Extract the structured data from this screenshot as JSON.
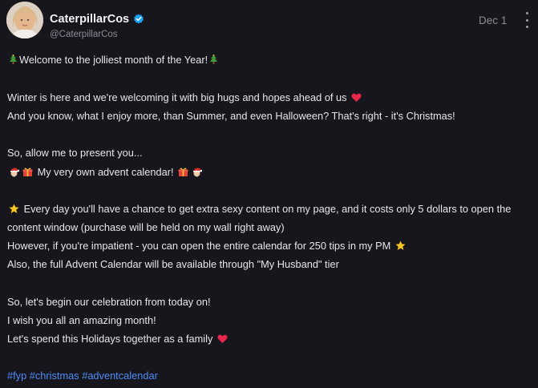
{
  "author": {
    "name": "CaterpillarCos",
    "handle": "@CaterpillarCos"
  },
  "post": {
    "date": "Dec 1",
    "lines": {
      "l1": "Welcome to the jolliest month of the Year!",
      "l2": "Winter is here and we're welcoming it with big hugs and hopes ahead of us",
      "l3": "And you know, what I enjoy more, than Summer, and even Halloween? That's right - it's Christmas!",
      "l4": "So, allow me to present you...",
      "l5": "My very own advent calendar!",
      "l6": "Every day you'll have a chance to get extra sexy content on my page, and it costs only 5 dollars to open the",
      "l7": "content window (purchase will be held on my wall right away)",
      "l8": "However, if you're impatient - you can open the entire calendar for 250 tips in my PM",
      "l9": "Also, the full Advent Calendar will be available through \"My Husband\" tier",
      "l10": "So, let's begin our celebration from today on!",
      "l11": "I wish you all an amazing month!",
      "l12": "Let's spend this Holidays together as a family"
    },
    "hashtags": [
      "#fyp",
      "#christmas",
      "#adventcalendar"
    ]
  },
  "icons": {
    "verified": "verified-badge-icon",
    "more": "more-options-icon",
    "tree": "christmas-tree-icon",
    "heart": "heart-icon",
    "santa": "santa-icon",
    "gift": "gift-icon",
    "star": "star-icon"
  },
  "colors": {
    "background": "#16161c",
    "text": "#e7e7ea",
    "muted": "#8a8d96",
    "link": "#4e8cf7",
    "verified": "#1da1f2",
    "heart": "#e8264a"
  }
}
